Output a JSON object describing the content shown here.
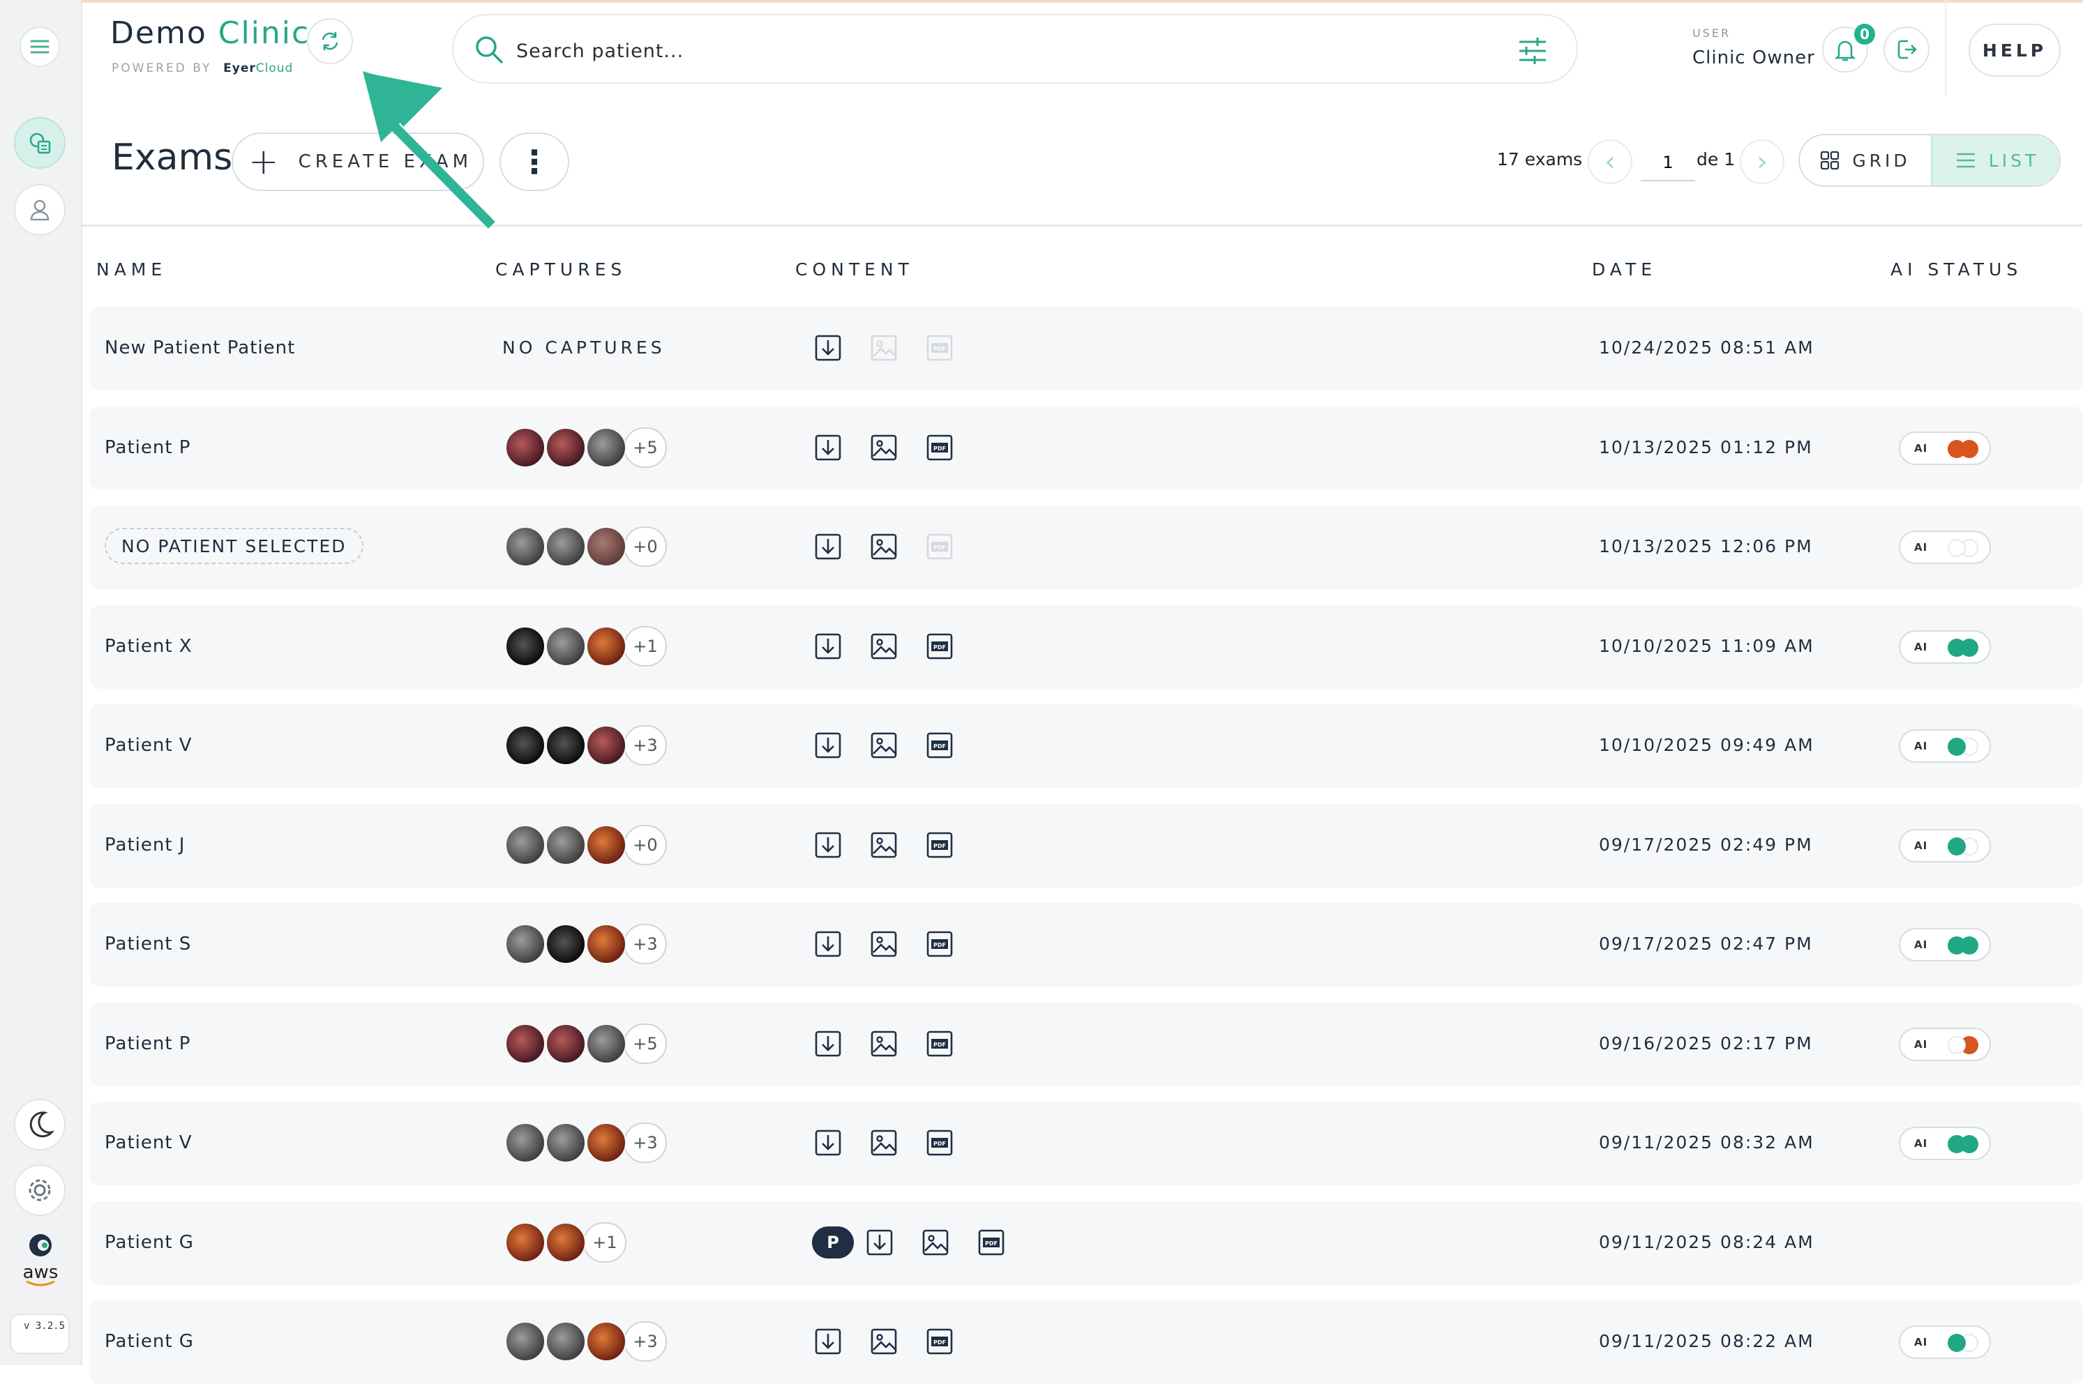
{
  "app": {
    "clinic_name_part1": "Demo",
    "clinic_name_part2": "Clinic",
    "powered_by": "POWERED BY",
    "brand_part1": "Eyer",
    "brand_part2": "Cloud",
    "version": "v 3.2.5",
    "aws_label": "aws"
  },
  "search": {
    "placeholder": "Search patient..."
  },
  "user": {
    "label": "USER",
    "name": "Clinic Owner",
    "notifications": "0"
  },
  "header": {
    "help_label": "HELP"
  },
  "toolbar": {
    "title": "Exams",
    "create_label": "CREATE EXAM",
    "exam_count": "17 exams",
    "page": "1",
    "page_of": "de 1",
    "grid_label": "GRID",
    "list_label": "LIST",
    "active_view": "LIST"
  },
  "table": {
    "headers": [
      "NAME",
      "CAPTURES",
      "CONTENT",
      "DATE",
      "AI STATUS"
    ],
    "rows": [
      {
        "name": "New Patient Patient",
        "no_patient": false,
        "captures": [],
        "captures_label": "NO CAPTURES",
        "more": "",
        "p_badge": "",
        "download": true,
        "image": false,
        "pdf": false,
        "date": "10/24/2025 08:51 AM",
        "ai": null
      },
      {
        "name": "Patient P",
        "no_patient": false,
        "captures": [
          "dark-red",
          "dark-red",
          "gray"
        ],
        "captures_label": "",
        "more": "+5",
        "p_badge": "",
        "download": true,
        "image": true,
        "pdf": true,
        "date": "10/13/2025 01:12 PM",
        "ai": [
          "orange",
          "orange"
        ]
      },
      {
        "name": "NO PATIENT SELECTED",
        "no_patient": true,
        "captures": [
          "gray",
          "gray",
          "brown"
        ],
        "captures_label": "",
        "more": "+0",
        "p_badge": "",
        "download": true,
        "image": true,
        "pdf": false,
        "date": "10/13/2025 12:06 PM",
        "ai": [
          "empty",
          "empty"
        ]
      },
      {
        "name": "Patient X",
        "no_patient": false,
        "captures": [
          "black",
          "gray",
          "red"
        ],
        "captures_label": "",
        "more": "+1",
        "p_badge": "",
        "download": true,
        "image": true,
        "pdf": true,
        "date": "10/10/2025 11:09 AM",
        "ai": [
          "green",
          "green"
        ]
      },
      {
        "name": "Patient V",
        "no_patient": false,
        "captures": [
          "black",
          "black",
          "dark-red"
        ],
        "captures_label": "",
        "more": "+3",
        "p_badge": "",
        "download": true,
        "image": true,
        "pdf": true,
        "date": "10/10/2025 09:49 AM",
        "ai": [
          "green",
          "empty"
        ]
      },
      {
        "name": "Patient J",
        "no_patient": false,
        "captures": [
          "gray",
          "gray",
          "red"
        ],
        "captures_label": "",
        "more": "+0",
        "p_badge": "",
        "download": true,
        "image": true,
        "pdf": true,
        "date": "09/17/2025 02:49 PM",
        "ai": [
          "green",
          "empty"
        ]
      },
      {
        "name": "Patient S",
        "no_patient": false,
        "captures": [
          "gray",
          "black",
          "red"
        ],
        "captures_label": "",
        "more": "+3",
        "p_badge": "",
        "download": true,
        "image": true,
        "pdf": true,
        "date": "09/17/2025 02:47 PM",
        "ai": [
          "green",
          "green"
        ]
      },
      {
        "name": "Patient P",
        "no_patient": false,
        "captures": [
          "dark-red",
          "dark-red",
          "gray"
        ],
        "captures_label": "",
        "more": "+5",
        "p_badge": "",
        "download": true,
        "image": true,
        "pdf": true,
        "date": "09/16/2025 02:17 PM",
        "ai": [
          "empty",
          "orange"
        ]
      },
      {
        "name": "Patient V",
        "no_patient": false,
        "captures": [
          "gray",
          "gray",
          "red"
        ],
        "captures_label": "",
        "more": "+3",
        "p_badge": "",
        "download": true,
        "image": true,
        "pdf": true,
        "date": "09/11/2025 08:32 AM",
        "ai": [
          "green",
          "green"
        ]
      },
      {
        "name": "Patient G",
        "no_patient": false,
        "captures": [
          "red",
          "red"
        ],
        "captures_label": "",
        "more": "+1",
        "p_badge": "P",
        "download": true,
        "image": true,
        "pdf": true,
        "date": "09/11/2025 08:24 AM",
        "ai": null
      },
      {
        "name": "Patient G",
        "no_patient": false,
        "captures": [
          "gray",
          "gray",
          "red"
        ],
        "captures_label": "",
        "more": "+3",
        "p_badge": "",
        "download": true,
        "image": true,
        "pdf": true,
        "date": "09/11/2025 08:22 AM",
        "ai": [
          "green",
          "empty"
        ]
      }
    ]
  },
  "colors": {
    "accent": "#2aa58a",
    "navy": "#1e2f44",
    "ai_green": "#20a884",
    "ai_orange": "#d9541e",
    "annotation_arrow": "#2fb596"
  }
}
